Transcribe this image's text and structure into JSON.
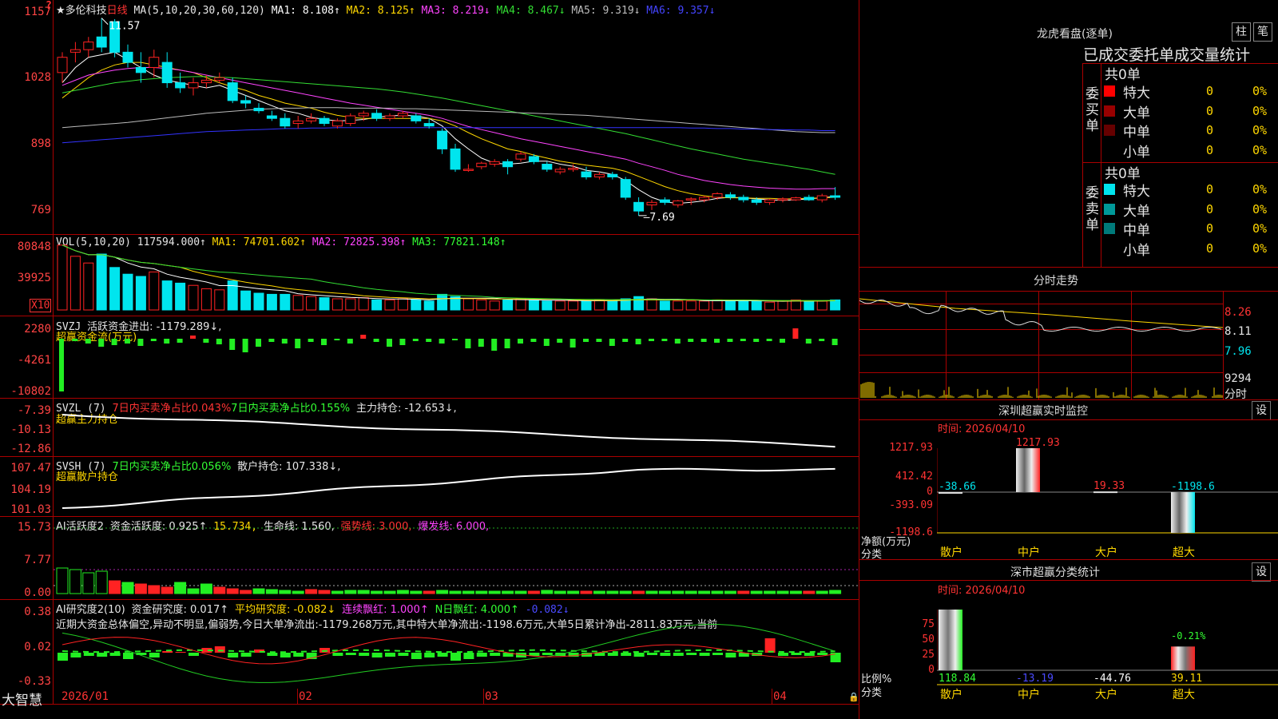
{
  "colors": {
    "bg": "#000000",
    "grid": "#aa0000",
    "up": "#ff2222",
    "down": "#00e5ee",
    "ma1": "#ffffff",
    "ma2": "#ffd700",
    "ma3": "#ff44ff",
    "ma4": "#33dd33",
    "ma5": "#bbbbbb",
    "ma6": "#3333ff"
  },
  "price_panel": {
    "question_icon": "?",
    "title": "★多伦科技",
    "period": "日线",
    "ma_label": "MA(5,10,20,30,60,120)",
    "ma_values": [
      {
        "name": "MA1:",
        "value": "8.108↑",
        "color": "#ffffff"
      },
      {
        "name": "MA2:",
        "value": "8.125↑",
        "color": "#ffd700"
      },
      {
        "name": "MA3:",
        "value": "8.219↓",
        "color": "#ff44ff"
      },
      {
        "name": "MA4:",
        "value": "8.467↓",
        "color": "#33dd33"
      },
      {
        "name": "MA5:",
        "value": "9.319↓",
        "color": "#bbbbbb"
      },
      {
        "name": "MA6:",
        "value": "9.357↓",
        "color": "#4444ff"
      }
    ],
    "y_ticks": [
      "1157",
      "1028",
      "898",
      "769"
    ],
    "high_label": "11.57",
    "low_label": "7.69"
  },
  "volume_panel": {
    "label": "VOL(5,10,20)",
    "value": "117594.000↑",
    "ma1": "MA1: 74701.602↑",
    "ma2": "MA2: 72825.398↑",
    "ma3": "MA3: 77821.148↑",
    "y_ticks": [
      "80848",
      "39925"
    ],
    "unit": "X10"
  },
  "svzj_panel": {
    "label": "SVZJ",
    "text1": "活跃资金进出: -1179.289↓,",
    "text2": "超赢资金流(万元)",
    "y_ticks": [
      "2280",
      "-4261",
      "-10802"
    ]
  },
  "svzl_panel": {
    "label": "SVZL (7)",
    "text1": "7日内买卖净占比0.043%",
    "text2": "7日内买卖净占比0.155%",
    "text3": "主力持仓: -12.653↓,",
    "text4": "超赢主力持仓",
    "y_ticks": [
      "-7.39",
      "-10.13",
      "-12.86"
    ]
  },
  "svsh_panel": {
    "label": "SVSH (7)",
    "text1": "7日内买卖净占比0.056%",
    "text2": "散户持仓: 107.338↓,",
    "text3": "超赢散户持仓",
    "y_ticks": [
      "107.47",
      "104.19",
      "101.03"
    ]
  },
  "ai2_panel": {
    "label": "AI活跃度2",
    "t1": "资金活跃度: 0.925↑",
    "t2": "15.734,",
    "t3": "生命线: 1.560,",
    "t4": "强势线: 3.000,",
    "t5": "爆发线: 6.000,",
    "y_ticks": [
      "15.73",
      "7.77",
      "0.00"
    ]
  },
  "ai_research_panel": {
    "label": "AI研究度2(10)",
    "t1": "资金研究度: 0.017↑",
    "t2": "平均研究度: -0.082↓",
    "t3": "连续飘红: 1.000↑",
    "t4": "N日飘红: 4.000↑",
    "t5": "-0.082↓",
    "summary": "近期大资金总体偏空,异动不明显,偏弱势,今日大单净流出:-1179.268万元,其中特大单净流出:-1198.6万元,大单5日累计净出-2811.83万元,当前",
    "y_ticks": [
      "0.38",
      "0.02",
      "-0.33"
    ]
  },
  "x_axis": {
    "dates": [
      "2026/01",
      "02",
      "03",
      "04"
    ]
  },
  "footer_brand": "大智慧",
  "dragon": {
    "title": "龙虎看盘(逐单)",
    "tab1": "柱",
    "tab2": "笔",
    "subtitle": "已成交委托单成交量统计",
    "buy_label": "委买单",
    "sell_label": "委卖单",
    "buy_total": "共0单",
    "sell_total": "共0单",
    "buy_rows": [
      {
        "name": "特大",
        "count": "0",
        "pct": "0%",
        "color": "#ff0000"
      },
      {
        "name": "大单",
        "count": "0",
        "pct": "0%",
        "color": "#990000"
      },
      {
        "name": "中单",
        "count": "0",
        "pct": "0%",
        "color": "#660000"
      },
      {
        "name": "小单",
        "count": "0",
        "pct": "0%",
        "color": ""
      }
    ],
    "sell_rows": [
      {
        "name": "特大",
        "count": "0",
        "pct": "0%",
        "color": "#00e5ee"
      },
      {
        "name": "大单",
        "count": "0",
        "pct": "0%",
        "color": "#009999"
      },
      {
        "name": "中单",
        "count": "0",
        "pct": "0%",
        "color": "#007a7a"
      },
      {
        "name": "小单",
        "count": "0",
        "pct": "0%",
        "color": ""
      }
    ]
  },
  "intraday": {
    "title": "分时走势",
    "prices": [
      "8.26",
      "8.11",
      "7.96"
    ],
    "volume": "9294",
    "unit": "分时"
  },
  "sz_monitor": {
    "title": "深圳超赢实时监控",
    "btn": "设",
    "time": "时间: 2026/04/10",
    "y_ticks": [
      "1217.93",
      "412.42",
      "0",
      "-393.09",
      "-1198.6"
    ],
    "ylabel1": "净额(万元)",
    "ylabel2": "分类",
    "categories": [
      "散户",
      "中户",
      "大户",
      "超大"
    ],
    "values": [
      "-38.66",
      "1217.93",
      "19.33",
      "-1198.6"
    ]
  },
  "sz_class": {
    "title": "深市超赢分类统计",
    "btn": "设",
    "time": "时间: 2026/04/10",
    "y_ticks": [
      "75",
      "50",
      "25",
      "0"
    ],
    "ylabel1": "比例%",
    "ylabel2": "分类",
    "categories": [
      "散户",
      "中户",
      "大户",
      "超大"
    ],
    "values": [
      "118.84",
      "-13.19",
      "-44.76",
      "39.11"
    ],
    "annot": "-0.21%"
  },
  "chart_data": {
    "type": "candlestick",
    "title": "多伦科技 日线",
    "x_ticks": [
      "2026/01",
      "02",
      "03",
      "04"
    ],
    "candles_ohlc": [
      [
        10.5,
        10.9,
        10.3,
        10.8
      ],
      [
        10.9,
        11.1,
        10.7,
        10.95
      ],
      [
        10.95,
        11.2,
        10.8,
        11.1
      ],
      [
        11.2,
        11.57,
        10.9,
        11.0
      ],
      [
        11.5,
        11.55,
        10.8,
        10.9
      ],
      [
        10.9,
        11.05,
        10.6,
        10.7
      ],
      [
        10.6,
        10.9,
        10.3,
        10.5
      ],
      [
        10.6,
        10.95,
        10.4,
        10.8
      ],
      [
        10.7,
        10.9,
        10.2,
        10.3
      ],
      [
        10.3,
        10.5,
        10.1,
        10.2
      ],
      [
        10.2,
        10.4,
        10.05,
        10.3
      ],
      [
        10.3,
        10.45,
        10.2,
        10.35
      ],
      [
        10.35,
        10.5,
        10.3,
        10.4
      ],
      [
        10.3,
        10.4,
        9.9,
        9.95
      ],
      [
        9.95,
        10.05,
        9.8,
        9.9
      ],
      [
        9.8,
        9.9,
        9.7,
        9.75
      ],
      [
        9.65,
        9.75,
        9.55,
        9.6
      ],
      [
        9.6,
        9.7,
        9.4,
        9.45
      ],
      [
        9.5,
        9.65,
        9.4,
        9.55
      ],
      [
        9.55,
        9.7,
        9.5,
        9.6
      ],
      [
        9.6,
        9.65,
        9.45,
        9.5
      ],
      [
        9.45,
        9.6,
        9.4,
        9.55
      ],
      [
        9.5,
        9.7,
        9.45,
        9.65
      ],
      [
        9.65,
        9.75,
        9.55,
        9.7
      ],
      [
        9.7,
        9.78,
        9.55,
        9.6
      ],
      [
        9.6,
        9.7,
        9.55,
        9.65
      ],
      [
        9.65,
        9.75,
        9.6,
        9.7
      ],
      [
        9.65,
        9.7,
        9.5,
        9.55
      ],
      [
        9.5,
        9.6,
        9.4,
        9.45
      ],
      [
        9.35,
        9.4,
        8.9,
        9.0
      ],
      [
        9.0,
        9.1,
        8.55,
        8.6
      ],
      [
        8.6,
        8.7,
        8.55,
        8.6
      ],
      [
        8.65,
        8.75,
        8.6,
        8.72
      ],
      [
        8.7,
        8.8,
        8.65,
        8.75
      ],
      [
        8.75,
        8.8,
        8.5,
        8.65
      ],
      [
        8.8,
        8.95,
        8.75,
        8.9
      ],
      [
        8.85,
        8.9,
        8.7,
        8.75
      ],
      [
        8.7,
        8.75,
        8.55,
        8.6
      ],
      [
        8.55,
        8.65,
        8.5,
        8.6
      ],
      [
        8.6,
        8.7,
        8.55,
        8.62
      ],
      [
        8.55,
        8.65,
        8.4,
        8.45
      ],
      [
        8.45,
        8.55,
        8.4,
        8.5
      ],
      [
        8.5,
        8.55,
        8.4,
        8.45
      ],
      [
        8.4,
        8.45,
        8.0,
        8.05
      ],
      [
        7.95,
        8.05,
        7.69,
        7.78
      ],
      [
        7.9,
        8.0,
        7.8,
        7.95
      ],
      [
        8.0,
        8.05,
        7.9,
        7.95
      ],
      [
        7.9,
        8.0,
        7.85,
        7.98
      ],
      [
        8.0,
        8.05,
        7.9,
        8.02
      ],
      [
        8.0,
        8.08,
        7.95,
        8.05
      ],
      [
        8.05,
        8.15,
        8.0,
        8.12
      ],
      [
        8.1,
        8.15,
        8.0,
        8.05
      ],
      [
        8.05,
        8.1,
        7.95,
        8.0
      ],
      [
        8.0,
        8.05,
        7.9,
        7.95
      ],
      [
        7.95,
        8.02,
        7.9,
        8.0
      ],
      [
        8.0,
        8.05,
        7.95,
        8.02
      ],
      [
        8.0,
        8.06,
        7.98,
        8.04
      ],
      [
        8.05,
        8.1,
        7.98,
        8.0
      ],
      [
        8.0,
        8.12,
        7.95,
        8.08
      ],
      [
        8.08,
        8.25,
        8.0,
        8.05
      ]
    ],
    "volume": [
      5.8,
      4.8,
      4.2,
      5.0,
      3.8,
      3.2,
      3.0,
      3.4,
      2.6,
      2.4,
      2.2,
      1.9,
      1.8,
      2.6,
      1.7,
      1.5,
      1.4,
      1.4,
      1.3,
      1.2,
      1.1,
      1.0,
      1.0,
      1.1,
      0.9,
      0.9,
      1.0,
      0.9,
      0.8,
      1.4,
      1.2,
      1.0,
      0.9,
      0.8,
      0.9,
      1.0,
      0.9,
      0.8,
      0.8,
      0.8,
      0.8,
      0.9,
      0.8,
      1.0,
      1.2,
      1.0,
      0.8,
      0.8,
      0.8,
      0.8,
      0.9,
      0.8,
      0.8,
      0.8,
      0.7,
      0.8,
      0.9,
      0.8,
      0.8,
      0.9
    ],
    "ma_series": [
      {
        "name": "MA1",
        "color": "#ffffff",
        "values": [
          10.3,
          10.6,
          10.8,
          10.85,
          10.9,
          10.75,
          10.6,
          10.45,
          10.35,
          10.3,
          10.25,
          10.2,
          10.25,
          10.15,
          10.05,
          9.95,
          9.85,
          9.75,
          9.7,
          9.62,
          9.58,
          9.55,
          9.56,
          9.58,
          9.62,
          9.65,
          9.66,
          9.65,
          9.6,
          9.45,
          9.2,
          9.0,
          8.82,
          8.72,
          8.7,
          8.72,
          8.76,
          8.76,
          8.7,
          8.66,
          8.58,
          8.55,
          8.5,
          8.38,
          8.2,
          8.05,
          7.96,
          7.93,
          7.95,
          7.98,
          8.03,
          8.05,
          8.04,
          8.02,
          8.0,
          7.99,
          8.0,
          8.02,
          8.04,
          8.07
        ]
      },
      {
        "name": "MA2",
        "color": "#ffd700",
        "values": [
          10.0,
          10.2,
          10.4,
          10.55,
          10.65,
          10.7,
          10.7,
          10.65,
          10.6,
          10.55,
          10.5,
          10.4,
          10.3,
          10.22,
          10.15,
          10.05,
          9.98,
          9.9,
          9.85,
          9.8,
          9.72,
          9.66,
          9.62,
          9.6,
          9.6,
          9.6,
          9.6,
          9.6,
          9.6,
          9.55,
          9.45,
          9.32,
          9.2,
          9.1,
          9.0,
          8.95,
          8.88,
          8.82,
          8.76,
          8.72,
          8.68,
          8.65,
          8.62,
          8.56,
          8.46,
          8.36,
          8.26,
          8.18,
          8.12,
          8.08,
          8.05,
          8.04,
          8.04,
          8.03,
          8.03,
          8.02,
          8.02,
          8.03,
          8.04,
          8.05
        ]
      },
      {
        "name": "MA3",
        "color": "#ff44ff",
        "values": [
          10.25,
          10.35,
          10.45,
          10.5,
          10.55,
          10.58,
          10.6,
          10.6,
          10.58,
          10.55,
          10.5,
          10.45,
          10.4,
          10.35,
          10.3,
          10.25,
          10.2,
          10.15,
          10.1,
          10.05,
          10.0,
          9.95,
          9.9,
          9.86,
          9.82,
          9.78,
          9.74,
          9.7,
          9.66,
          9.6,
          9.52,
          9.44,
          9.38,
          9.32,
          9.26,
          9.2,
          9.15,
          9.1,
          9.05,
          9.0,
          8.95,
          8.9,
          8.85,
          8.8,
          8.72,
          8.65,
          8.58,
          8.5,
          8.44,
          8.38,
          8.34,
          8.3,
          8.27,
          8.25,
          8.23,
          8.22,
          8.21,
          8.21,
          8.22,
          8.22
        ]
      },
      {
        "name": "MA4",
        "color": "#33dd33",
        "values": [
          10.1,
          10.15,
          10.2,
          10.25,
          10.3,
          10.33,
          10.36,
          10.38,
          10.4,
          10.41,
          10.42,
          10.42,
          10.41,
          10.4,
          10.38,
          10.36,
          10.34,
          10.32,
          10.3,
          10.28,
          10.26,
          10.24,
          10.22,
          10.2,
          10.18,
          10.15,
          10.12,
          10.08,
          10.04,
          10.0,
          9.95,
          9.9,
          9.85,
          9.8,
          9.75,
          9.7,
          9.65,
          9.6,
          9.55,
          9.5,
          9.45,
          9.4,
          9.35,
          9.3,
          9.24,
          9.18,
          9.12,
          9.06,
          9.0,
          8.95,
          8.9,
          8.85,
          8.8,
          8.76,
          8.72,
          8.68,
          8.64,
          8.6,
          8.55,
          8.5
        ]
      },
      {
        "name": "MA5",
        "color": "#bbbbbb",
        "values": [
          9.42,
          9.44,
          9.46,
          9.48,
          9.5,
          9.52,
          9.55,
          9.58,
          9.61,
          9.64,
          9.67,
          9.7,
          9.72,
          9.74,
          9.76,
          9.78,
          9.79,
          9.8,
          9.8,
          9.81,
          9.81,
          9.81,
          9.8,
          9.8,
          9.8,
          9.8,
          9.79,
          9.79,
          9.78,
          9.77,
          9.76,
          9.75,
          9.74,
          9.73,
          9.72,
          9.71,
          9.7,
          9.69,
          9.68,
          9.67,
          9.66,
          9.64,
          9.62,
          9.6,
          9.58,
          9.56,
          9.54,
          9.52,
          9.5,
          9.48,
          9.46,
          9.44,
          9.42,
          9.4,
          9.38,
          9.36,
          9.34,
          9.33,
          9.32,
          9.32
        ]
      },
      {
        "name": "MA6",
        "color": "#3333ff",
        "values": [
          9.12,
          9.14,
          9.16,
          9.18,
          9.2,
          9.22,
          9.24,
          9.26,
          9.28,
          9.3,
          9.32,
          9.34,
          9.35,
          9.36,
          9.37,
          9.38,
          9.39,
          9.4,
          9.4,
          9.41,
          9.41,
          9.42,
          9.42,
          9.42,
          9.42,
          9.42,
          9.42,
          9.42,
          9.42,
          9.42,
          9.42,
          9.42,
          9.42,
          9.42,
          9.42,
          9.42,
          9.42,
          9.42,
          9.42,
          9.42,
          9.42,
          9.42,
          9.42,
          9.42,
          9.42,
          9.42,
          9.42,
          9.42,
          9.41,
          9.41,
          9.4,
          9.4,
          9.39,
          9.39,
          9.38,
          9.38,
          9.37,
          9.37,
          9.36,
          9.36
        ]
      }
    ],
    "ylim": [
      7.5,
      11.8
    ]
  }
}
